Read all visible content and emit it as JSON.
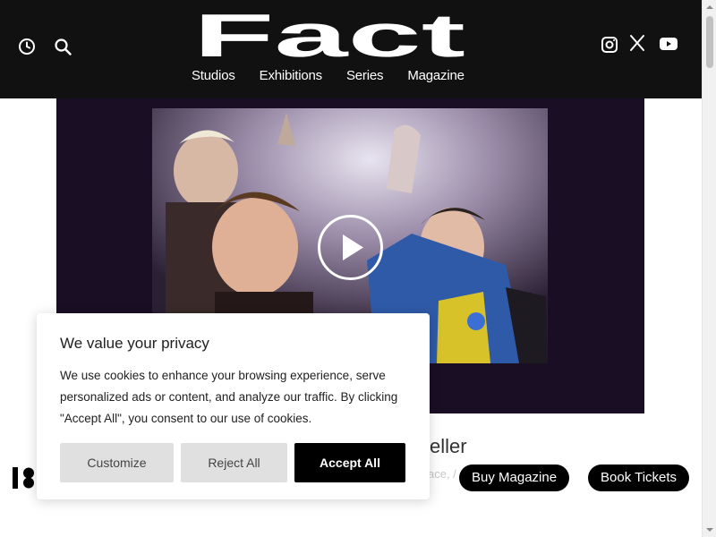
{
  "header": {
    "logo_text": "Fact",
    "nav": [
      "Studios",
      "Exhibitions",
      "Series",
      "Magazine"
    ],
    "left_icons": [
      "clock-icon",
      "search-icon"
    ],
    "social_icons": [
      "instagram-icon",
      "x-icon",
      "youtube-icon"
    ]
  },
  "article": {
    "title_fragment": "eller",
    "meta_fragment": "ace, /  ·  e-V"
  },
  "actions": {
    "buy_magazine": "Buy Magazine",
    "book_tickets": "Book Tickets"
  },
  "cookie": {
    "title": "We value your privacy",
    "text": "We use cookies to enhance your browsing experience, serve personalized ads or content, and analyze our traffic. By clicking \"Accept All\", you consent to our use of cookies.",
    "customize": "Customize",
    "reject": "Reject All",
    "accept": "Accept All"
  },
  "colors": {
    "header_bg": "#111111",
    "media_bg": "#1a0e24",
    "button_dark": "#000000",
    "button_grey": "#e0e0e0"
  }
}
